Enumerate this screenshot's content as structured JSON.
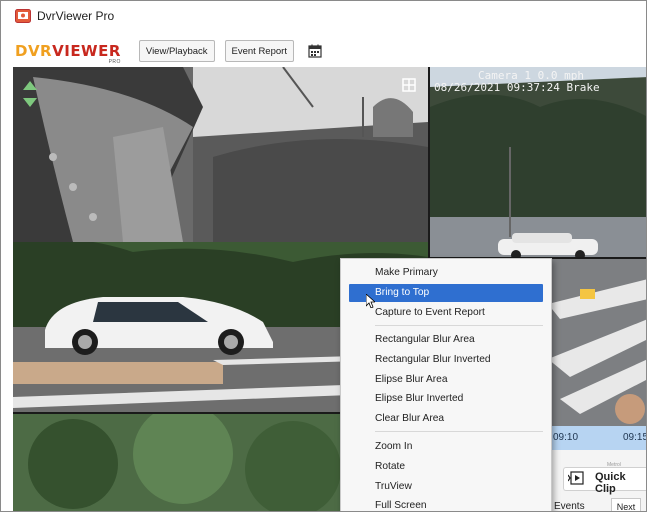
{
  "window": {
    "title": "DvrViewer Pro"
  },
  "toolbar": {
    "logo_dvr": "DVR",
    "logo_viewer": "VIEWER",
    "logo_sub": "PRO",
    "view_playback_label": "View/Playback",
    "event_report_label": "Event Report",
    "calendar_icon": "calendar-icon"
  },
  "cameras": {
    "top_right": {
      "line1": "Camera 1   0.0 mph",
      "line2": "08/26/2021 09:37:24  Brake"
    }
  },
  "context_menu": {
    "items": [
      {
        "label": "Make Primary"
      },
      {
        "label": "Bring to Top"
      },
      {
        "label": "Capture to Event Report"
      },
      {
        "label": "Rectangular Blur Area"
      },
      {
        "label": "Rectangular Blur Inverted"
      },
      {
        "label": "Elipse Blur Area"
      },
      {
        "label": "Elipse Blur Inverted"
      },
      {
        "label": "Clear Blur Area"
      },
      {
        "label": "Zoom In"
      },
      {
        "label": "Rotate"
      },
      {
        "label": "TruView"
      },
      {
        "label": "Full Screen"
      }
    ],
    "highlighted_index": 1
  },
  "timeline": {
    "ticks": [
      "09:10",
      "09:15"
    ]
  },
  "quick_clip": {
    "label": "Quick Clip",
    "meta": "Metrol"
  },
  "events": {
    "tab_label": "Events",
    "next_label": "Next"
  },
  "colors": {
    "menu_highlight": "#2f6fd0",
    "timeline_bg": "#b7d4f2",
    "logo_orange": "#f0a020",
    "logo_red": "#c8281e"
  }
}
